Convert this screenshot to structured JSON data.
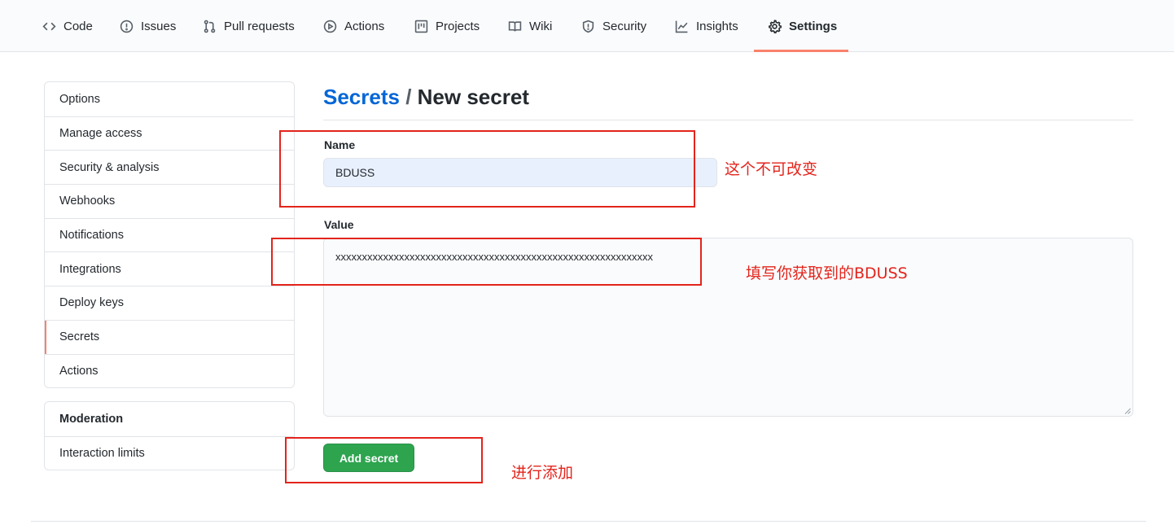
{
  "repo_nav": {
    "tabs": [
      {
        "label": "Code",
        "icon": "code-icon"
      },
      {
        "label": "Issues",
        "icon": "issue-icon"
      },
      {
        "label": "Pull requests",
        "icon": "pull-request-icon"
      },
      {
        "label": "Actions",
        "icon": "play-icon"
      },
      {
        "label": "Projects",
        "icon": "project-icon"
      },
      {
        "label": "Wiki",
        "icon": "book-icon"
      },
      {
        "label": "Security",
        "icon": "shield-icon"
      },
      {
        "label": "Insights",
        "icon": "graph-icon"
      },
      {
        "label": "Settings",
        "icon": "gear-icon",
        "selected": true
      }
    ],
    "accent_color": "#f9826c"
  },
  "sidebar": {
    "items": [
      "Options",
      "Manage access",
      "Security & analysis",
      "Webhooks",
      "Notifications",
      "Integrations",
      "Deploy keys",
      "Secrets",
      "Actions"
    ],
    "selected": "Secrets",
    "moderation": {
      "heading": "Moderation",
      "items": [
        "Interaction limits"
      ]
    }
  },
  "main": {
    "title_link": "Secrets",
    "title_separator": " / ",
    "title_rest": "New secret",
    "name_label": "Name",
    "name_value": "BDUSS",
    "value_label": "Value",
    "value_value": "xxxxxxxxxxxxxxxxxxxxxxxxxxxxxxxxxxxxxxxxxxxxxxxxxxxxxxxxxxxx",
    "add_button": "Add secret",
    "button_color": "#2ea44f"
  },
  "annotations": {
    "name_note": "这个不可改变",
    "value_note": "填写你获取到的BDUSS",
    "button_note": "进行添加",
    "color": "#e3241c"
  }
}
